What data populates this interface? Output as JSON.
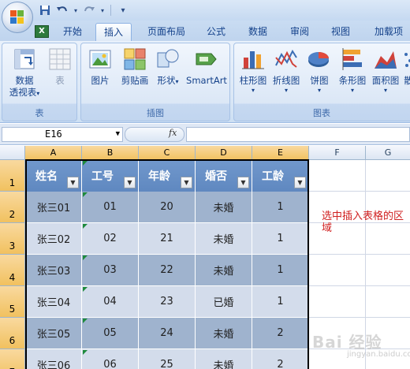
{
  "quick_access": {
    "icons": [
      "save-icon",
      "undo-icon",
      "redo-icon",
      "customize-icon"
    ]
  },
  "tabs": [
    {
      "label": "开始",
      "active": false
    },
    {
      "label": "插入",
      "active": true
    },
    {
      "label": "页面布局",
      "active": false
    },
    {
      "label": "公式",
      "active": false
    },
    {
      "label": "数据",
      "active": false
    },
    {
      "label": "审阅",
      "active": false
    },
    {
      "label": "视图",
      "active": false
    },
    {
      "label": "加载项",
      "active": false
    }
  ],
  "ribbon": {
    "groups": [
      {
        "label": "表",
        "buttons": [
          {
            "label": "数据",
            "label2": "透视表",
            "icon": "pivot-table-icon"
          },
          {
            "label": "表",
            "icon": "table-icon",
            "disabled": true
          }
        ]
      },
      {
        "label": "插图",
        "buttons": [
          {
            "label": "图片",
            "icon": "picture-icon"
          },
          {
            "label": "剪贴画",
            "icon": "clipart-icon"
          },
          {
            "label": "形状",
            "icon": "shapes-icon"
          },
          {
            "label": "SmartArt",
            "icon": "smartart-icon"
          }
        ]
      },
      {
        "label": "图表",
        "buttons": [
          {
            "label": "柱形图",
            "icon": "column-chart-icon"
          },
          {
            "label": "折线图",
            "icon": "line-chart-icon"
          },
          {
            "label": "饼图",
            "icon": "pie-chart-icon"
          },
          {
            "label": "条形图",
            "icon": "bar-chart-icon"
          },
          {
            "label": "面积图",
            "icon": "area-chart-icon"
          },
          {
            "label": "散",
            "icon": "scatter-chart-icon"
          }
        ]
      }
    ]
  },
  "formula_bar": {
    "name_box": "E16",
    "fx_label": "fx",
    "formula_value": ""
  },
  "columns": [
    "A",
    "B",
    "C",
    "D",
    "E",
    "F",
    "G"
  ],
  "rows": [
    "1",
    "2",
    "3",
    "4",
    "5",
    "6",
    "7"
  ],
  "table": {
    "headers": [
      "姓名",
      "工号",
      "年龄",
      "婚否",
      "工龄"
    ],
    "rows": [
      [
        "张三01",
        "01",
        "20",
        "未婚",
        "1"
      ],
      [
        "张三02",
        "02",
        "21",
        "未婚",
        "1"
      ],
      [
        "张三03",
        "03",
        "22",
        "未婚",
        "1"
      ],
      [
        "张三04",
        "04",
        "23",
        "已婚",
        "1"
      ],
      [
        "张三05",
        "05",
        "24",
        "未婚",
        "2"
      ],
      [
        "张三06",
        "06",
        "25",
        "未婚",
        "2"
      ]
    ],
    "header_color": "#5f88c0",
    "band_dark": "#9fb3ce",
    "band_light": "#d3dceb"
  },
  "annotation": {
    "text": "选中插入表格的区域",
    "color": "#d02020"
  },
  "watermark": {
    "text": "Bai 经验",
    "sub": "jingyan.baidu.com"
  }
}
